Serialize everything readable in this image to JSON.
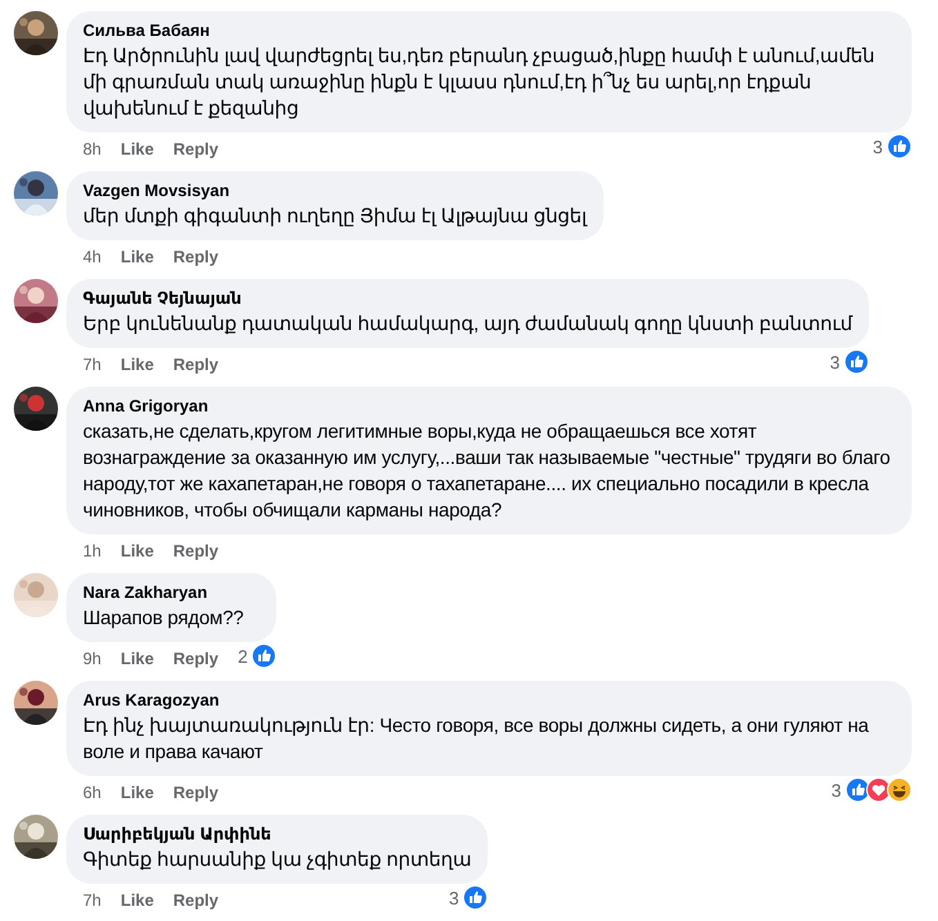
{
  "comments": [
    {
      "author": "Сильва Бабаян",
      "text": "Էդ Արծրունին լավ վարժեցրել ես,դեռ բերանդ չբացած,ինքը համփ է անում,ամեն մի գրառման տակ առաջինը ինքն է կլասս դնում,էդ ի՞նչ ես արել,որ էդքան վախենում է քեզանից",
      "time": "8h",
      "like": "Like",
      "reply": "Reply",
      "reaction_count": "3",
      "reactions": [
        {
          "kind": "like"
        }
      ]
    },
    {
      "author": "Vazgen Movsisyan",
      "text": "մեր մտքի գիգանտի ուղեղը Յիմա էլ Ալթայնա ցնցել",
      "time": "4h",
      "like": "Like",
      "reply": "Reply"
    },
    {
      "author": "Գայանե Չեյնայան",
      "text": "Երբ կունենանք դատական համակարգ, այդ ժամանակ գողը կնստի բանտում",
      "time": "7h",
      "like": "Like",
      "reply": "Reply",
      "reaction_count": "3",
      "reactions": [
        {
          "kind": "like"
        }
      ]
    },
    {
      "author": "Anna Grigoryan",
      "text": "сказать,не сделать,кругом легитимные воры,куда не обращаешься все хотят вознаграждение за оказанную им услугу,...ваши так называемые \"честные\" трудяги во благо народу,тот же кахапетаран,не говоря о тахапетаране.... их специально посадили в кресла чиновников, чтобы обчищали карманы народа?",
      "time": "1h",
      "like": "Like",
      "reply": "Reply"
    },
    {
      "author": "Nara Zakharyan",
      "text": "Шарапов рядом??",
      "time": "9h",
      "like": "Like",
      "reply": "Reply",
      "reaction_count": "2",
      "reactions": [
        {
          "kind": "like"
        }
      ]
    },
    {
      "author": "Arus Karagozyan",
      "text": "Էդ ինչ խայտառակություն էր: Често говоря, все воры должны сидеть, а они гуляют на воле и права качают",
      "time": "6h",
      "like": "Like",
      "reply": "Reply",
      "reaction_count": "3",
      "reactions": [
        {
          "kind": "like"
        },
        {
          "kind": "love"
        },
        {
          "kind": "haha"
        }
      ]
    },
    {
      "author": "Սարիբեկյան Արփինե",
      "text": "Գիտեք հարսանիք կա չգիտեք որտեղա",
      "time": "7h",
      "like": "Like",
      "reply": "Reply",
      "reaction_count": "3",
      "reactions": [
        {
          "kind": "like"
        }
      ]
    }
  ]
}
